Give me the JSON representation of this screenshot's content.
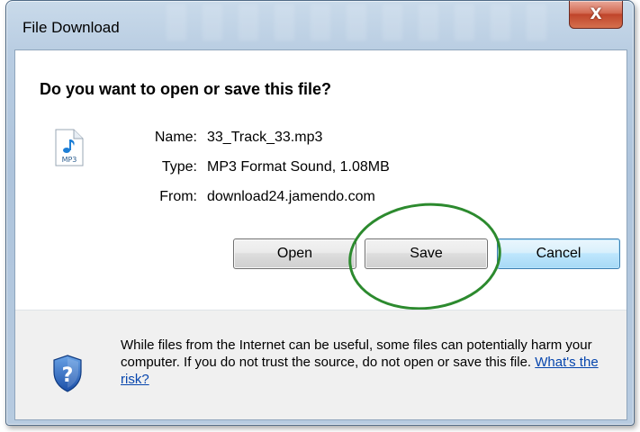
{
  "window": {
    "title": "File Download",
    "close_glyph": "X"
  },
  "dialog": {
    "question": "Do you want to open or save this file?",
    "file_icon": "mp3-file-icon",
    "file_icon_label": "MP3",
    "fields": [
      {
        "label": "Name:",
        "value": "33_Track_33.mp3"
      },
      {
        "label": "Type:",
        "value": "MP3 Format Sound, 1.08MB"
      },
      {
        "label": "From:",
        "value": "download24.jamendo.com"
      }
    ],
    "buttons": {
      "open": "Open",
      "save": "Save",
      "cancel": "Cancel"
    },
    "annotation_color": "#2c8a2e"
  },
  "footer": {
    "icon": "security-shield-question-icon",
    "warning_text": "While files from the Internet can be useful, some files can potentially harm your computer. If you do not trust the source, do not open or save this file.",
    "risk_link": "What's the risk?"
  }
}
